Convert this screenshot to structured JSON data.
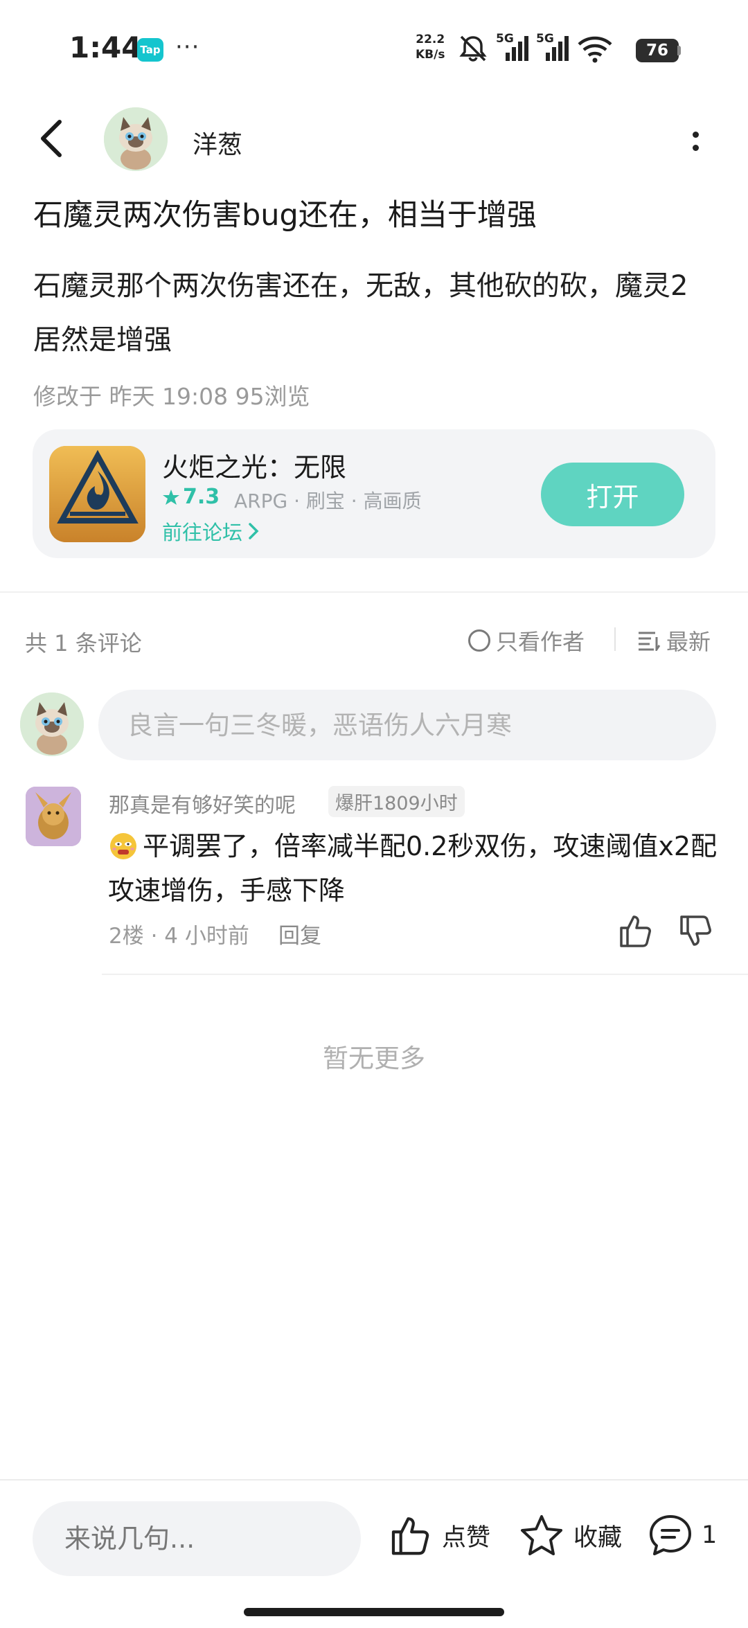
{
  "status_bar": {
    "time": "1:44",
    "app_badge": "Tap",
    "more": "···",
    "net_speed_value": "22.2",
    "net_speed_unit": "KB/s",
    "signal_1_label": "5G",
    "signal_2_label": "5G",
    "battery": "76"
  },
  "header": {
    "author_name": "洋葱"
  },
  "post": {
    "title": "石魔灵两次伤害bug还在，相当于增强",
    "body": "石魔灵那个两次伤害还在，无敌，其他砍的砍，魔灵2居然是增强",
    "meta": "修改于 昨天 19:08   95浏览"
  },
  "game_card": {
    "name": "火炬之光：无限",
    "rating": "7.3",
    "tags": "ARPG · 刷宝 · 高画质",
    "forum_link": "前往论坛",
    "open_label": "打开"
  },
  "comments_header": {
    "count_label": "共 1 条评论",
    "author_only_label": "只看作者",
    "sort_label": "最新"
  },
  "comment_input": {
    "placeholder": "良言一句三冬暖，恶语伤人六月寒"
  },
  "comments": [
    {
      "author": "那真是有够好笑的呢",
      "badge": "爆肝1809小时",
      "text": "平调罢了，倍率减半配0.2秒双伤，攻速阈值x2配攻速增伤，手感下降",
      "meta": "2楼 · 4 小时前",
      "reply_label": "回复"
    }
  ],
  "footer": {
    "no_more": "暂无更多"
  },
  "bottom_bar": {
    "input_placeholder": "来说几句...",
    "like_label": "点赞",
    "favorite_label": "收藏",
    "comment_count": "1"
  },
  "colors": {
    "accent": "#5fd4c1",
    "accent_text": "#2fc0a8",
    "tap_brand": "#15c5ce"
  }
}
